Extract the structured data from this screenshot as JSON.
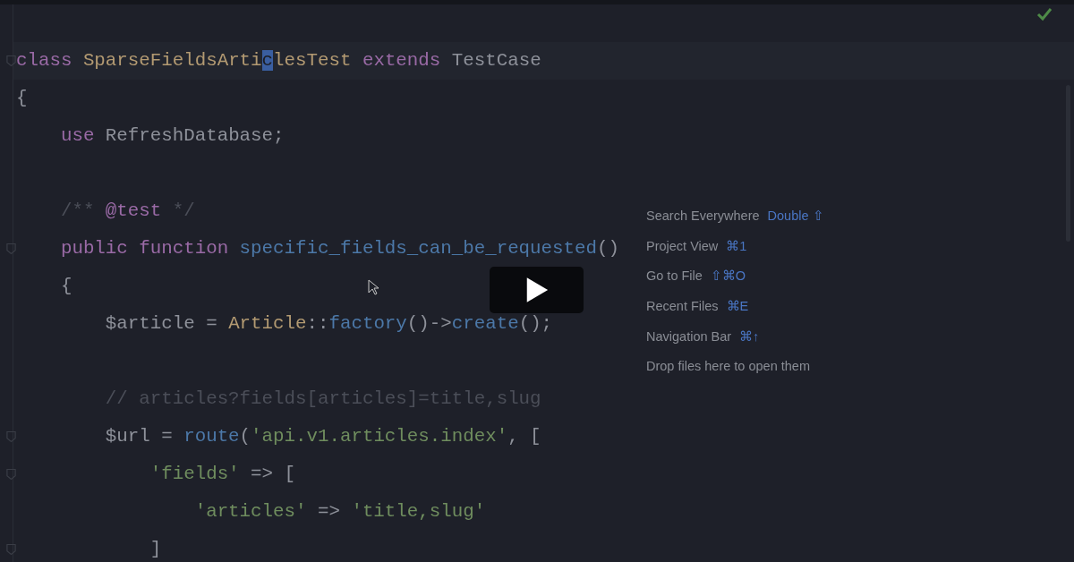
{
  "editor": {
    "lines": [
      {
        "fold": true,
        "current": true,
        "tokens": [
          {
            "kind": "keyword",
            "text": "class "
          },
          {
            "kind": "type",
            "text": "SparseFieldsArti"
          },
          {
            "kind": "caret",
            "text": "c"
          },
          {
            "kind": "type",
            "text": "lesTest"
          },
          {
            "kind": "keyword",
            "text": " extends "
          },
          {
            "kind": "plain",
            "text": "TestCase"
          }
        ]
      },
      {
        "fold": false,
        "current": false,
        "tokens": [
          {
            "kind": "plain",
            "text": "{"
          }
        ]
      },
      {
        "fold": false,
        "current": false,
        "tokens": [
          {
            "kind": "keyword",
            "text": "    use "
          },
          {
            "kind": "plain",
            "text": "RefreshDatabase;"
          }
        ]
      },
      {
        "kind": "blank"
      },
      {
        "fold": false,
        "current": false,
        "tokens": [
          {
            "kind": "comment",
            "text": "    /** "
          },
          {
            "kind": "keyword",
            "text": "@test"
          },
          {
            "kind": "comment",
            "text": " */"
          }
        ]
      },
      {
        "fold": true,
        "current": false,
        "tokens": [
          {
            "kind": "keyword",
            "text": "    public function "
          },
          {
            "kind": "function",
            "text": "specific_fields_can_be_requested"
          },
          {
            "kind": "plain",
            "text": "()"
          }
        ]
      },
      {
        "fold": false,
        "current": false,
        "tokens": [
          {
            "kind": "plain",
            "text": "    {"
          }
        ]
      },
      {
        "fold": false,
        "current": false,
        "tokens": [
          {
            "kind": "plain",
            "text": "        $article = "
          },
          {
            "kind": "type",
            "text": "Article"
          },
          {
            "kind": "plain",
            "text": "::"
          },
          {
            "kind": "function",
            "text": "factory"
          },
          {
            "kind": "plain",
            "text": "()->"
          },
          {
            "kind": "function",
            "text": "create"
          },
          {
            "kind": "plain",
            "text": "();"
          }
        ]
      },
      {
        "kind": "blank"
      },
      {
        "fold": false,
        "current": false,
        "tokens": [
          {
            "kind": "comment",
            "text": "        // articles?fields[articles]=title,slug"
          }
        ]
      },
      {
        "fold": true,
        "current": false,
        "tokens": [
          {
            "kind": "plain",
            "text": "        $url = "
          },
          {
            "kind": "function",
            "text": "route"
          },
          {
            "kind": "plain",
            "text": "("
          },
          {
            "kind": "string",
            "text": "'api.v1.articles.index'"
          },
          {
            "kind": "plain",
            "text": ", ["
          }
        ]
      },
      {
        "fold": true,
        "current": false,
        "tokens": [
          {
            "kind": "string",
            "text": "            'fields'"
          },
          {
            "kind": "plain",
            "text": " => ["
          }
        ]
      },
      {
        "fold": false,
        "current": false,
        "tokens": [
          {
            "kind": "string",
            "text": "                'articles'"
          },
          {
            "kind": "plain",
            "text": " => "
          },
          {
            "kind": "string",
            "text": "'title,slug'"
          }
        ]
      },
      {
        "fold": true,
        "current": false,
        "tokens": [
          {
            "kind": "plain",
            "text": "            ]"
          }
        ]
      }
    ]
  },
  "hints": [
    {
      "label": "Search Everywhere",
      "shortcut": "Double ⇧"
    },
    {
      "label": "Project View",
      "shortcut": "⌘1"
    },
    {
      "label": "Go to File",
      "shortcut": "⇧⌘O"
    },
    {
      "label": "Recent Files",
      "shortcut": "⌘E"
    },
    {
      "label": "Navigation Bar",
      "shortcut": "⌘↑"
    },
    {
      "label": "Drop files here to open them"
    }
  ]
}
